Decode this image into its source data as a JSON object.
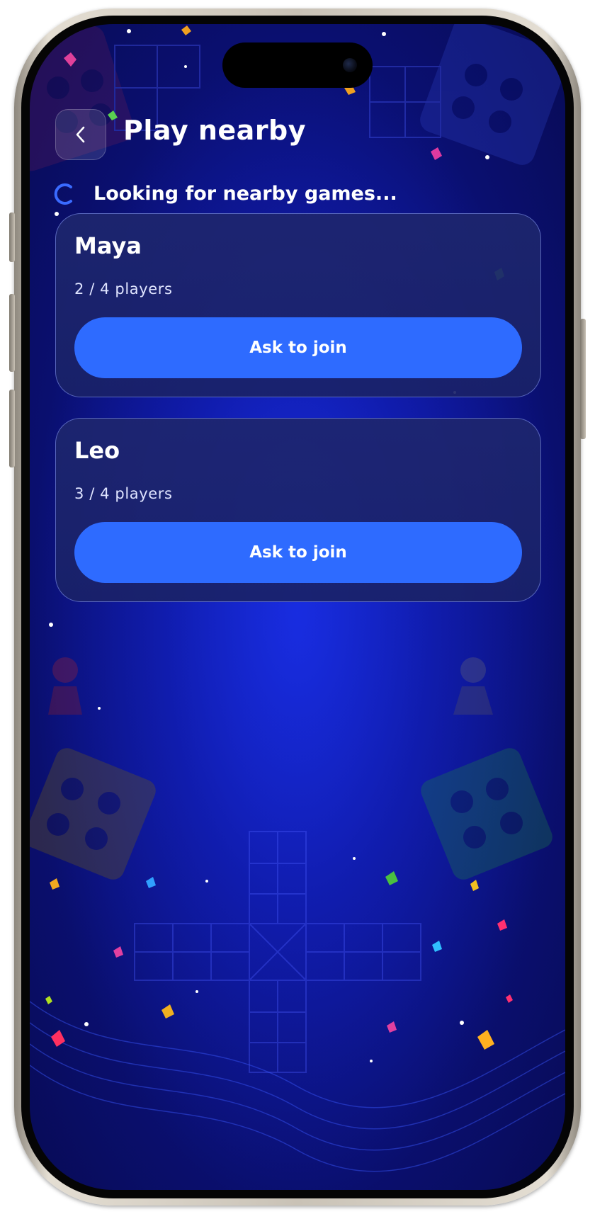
{
  "header": {
    "title": "Play nearby",
    "back_icon": "chevron-left-icon"
  },
  "status": {
    "text": "Looking for nearby games...",
    "icon": "loading-spinner-icon"
  },
  "games": [
    {
      "host": "Maya",
      "players": "2 / 4 players",
      "action": "Ask to join"
    },
    {
      "host": "Leo",
      "players": "3 / 4 players",
      "action": "Ask to join"
    }
  ],
  "colors": {
    "accent": "#2E6BFF",
    "background": "#0D1596",
    "card_border": "#8CA0FF",
    "text": "#FFFFFF"
  }
}
